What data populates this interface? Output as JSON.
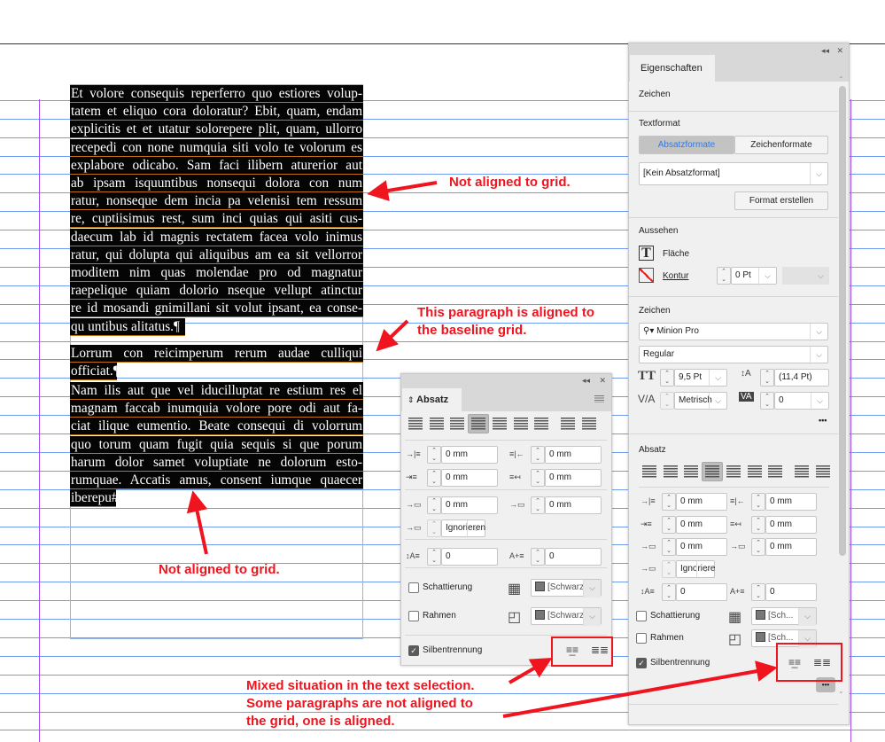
{
  "document": {
    "paragraph1_lines": [
      "Et volore consequis reperferro quo estiores volup-",
      "tatem et eliquo cora doloratur? Ebit, quam, endam",
      "explicitis et et utatur solorepere plit, quam, ullorro",
      "recepedi con none numquia siti volo te volorum es",
      "explabore odicabo. Sam faci ilibern aturerior aut",
      "ab ipsam isquuntibus nonsequi dolora con num",
      "ratur, nonseque dem incia pa velenisi tem ressum",
      "re, cuptiisimus rest, sum inci quias qui asiti cus-",
      "daecum lab id magnis rectatem facea volo inimus",
      "ratur, qui dolupta qui aliquibus am ea sit vellorror",
      "moditem nim quas molendae pro od magnatur",
      "raepelique quiam dolorio nseque vellupt atinctur",
      "re id mosandi gnimillani sit volut ipsant, ea conse-",
      "qu untibus alitatus.¶"
    ],
    "paragraph2_lines": [
      "Lorrum con reicimperum rerum audae culliqui",
      "officiat.¶"
    ],
    "paragraph3_lines": [
      "Nam ilis aut que vel iducilluptat re estium res el",
      "magnam faccab inumquia volore pore odi aut fa-",
      "ciat ilique eumentio. Beate consequi di volorrum",
      "quo torum quam fugit quia sequis si que porum",
      "harum dolor samet voluptiate ne dolorum esto-",
      "rumquae. Accatis amus, consent iumque quaecer",
      "iberepu#"
    ]
  },
  "annotations": {
    "top": "Not aligned to grid.",
    "middle": [
      "This paragraph is aligned to",
      "the baseline grid."
    ],
    "bottom": "Not aligned to grid.",
    "mixed": [
      "Mixed situation in the text selection.",
      "Some paragraphs are not aligned to",
      "the grid, one is aligned."
    ]
  },
  "absatz_panel": {
    "title": "Absatz",
    "left_indent": "0 mm",
    "right_indent": "0 mm",
    "first_line_indent": "0 mm",
    "last_line_indent": "0 mm",
    "space_before": "0 mm",
    "space_after": "0 mm",
    "span_columns": "Ignorieren",
    "drop_cap_lines": "0",
    "drop_cap_chars": "0",
    "shading_label": "Schattierung",
    "shading_color": "[Schwarz]",
    "border_label": "Rahmen",
    "border_color": "[Schwarz]",
    "hyphenation_label": "Silbentrennung"
  },
  "properties_panel": {
    "tab": "Eigenschaften",
    "section_zeichen_top": "Zeichen",
    "textformat": "Textformat",
    "tab_absatzformate": "Absatzformate",
    "tab_zeichenformate": "Zeichenformate",
    "paragraph_style": "[Kein Absatzformat]",
    "create_style": "Format erstellen",
    "aussehen": "Aussehen",
    "fill": "Fläche",
    "stroke": "Kontur",
    "stroke_weight": "0 Pt",
    "zeichen": "Zeichen",
    "font": "Minion Pro",
    "style": "Regular",
    "font_size": "9,5 Pt",
    "leading": "(11,4 Pt)",
    "kerning": "Metrisch",
    "tracking": "0",
    "absatz": "Absatz",
    "left_indent": "0 mm",
    "right_indent": "0 mm",
    "first_line_indent": "0 mm",
    "last_line_indent": "0 mm",
    "space_before": "0 mm",
    "space_after": "0 mm",
    "span_columns": "Ignoriere",
    "drop_cap_lines": "0",
    "drop_cap_chars": "0",
    "shading_label": "Schattierung",
    "shading_color": "[Sch...",
    "border_label": "Rahmen",
    "border_color": "[Sch...",
    "hyphenation_label": "Silbentrennung",
    "more": "•••"
  },
  "colors": {
    "annotation": "#f0141e",
    "grid": "#6f9cf0",
    "margin": "#a64df0",
    "accent_tab": "#2d7be5"
  }
}
